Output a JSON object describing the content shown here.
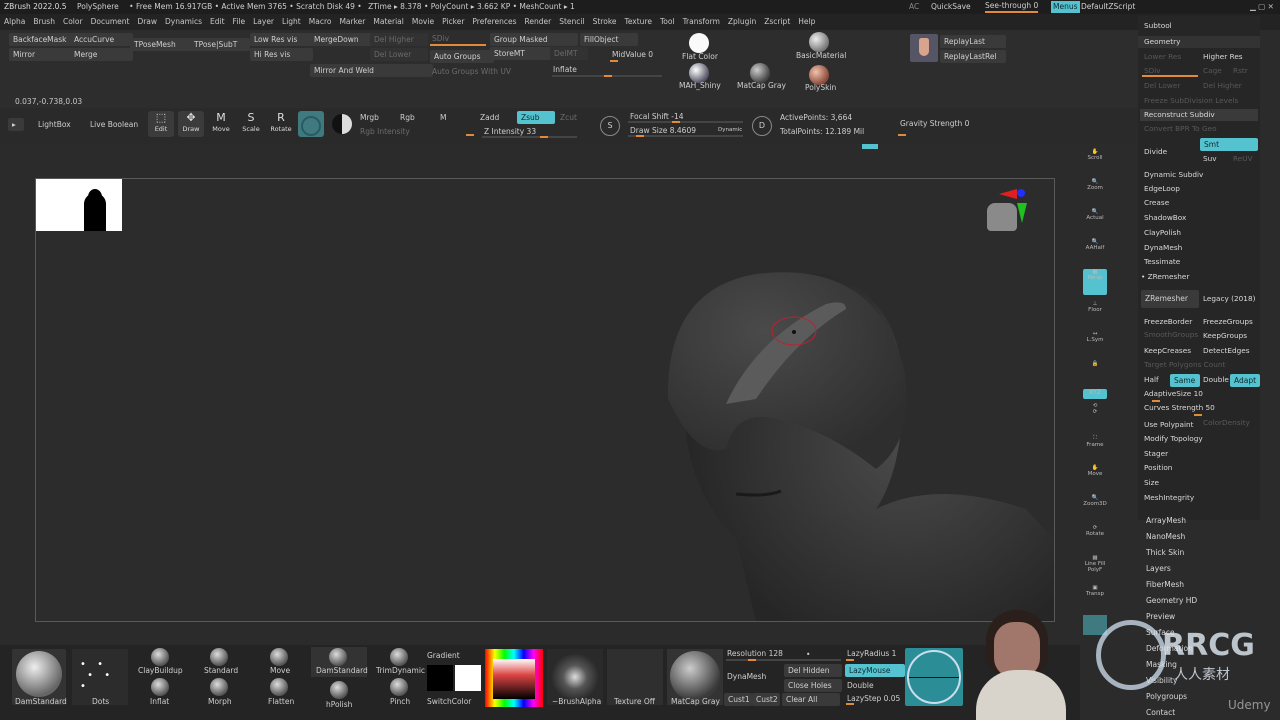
{
  "title_bar": {
    "app": "ZBrush 2022.0.5",
    "doc": "PolySphere",
    "stats": "• Free Mem 16.917GB • Active Mem 3765 • Scratch Disk 49 •",
    "ztime": "ZTime ▸ 8.378 • PolyCount ▸ 3.662 KP • MeshCount ▸ 1",
    "ac": "AC",
    "quicksave": "QuickSave",
    "seethrough": "See-through  0",
    "menus": "Menus",
    "script": "DefaultZScript"
  },
  "menu": [
    "Alpha",
    "Brush",
    "Color",
    "Document",
    "Draw",
    "Dynamics",
    "Edit",
    "File",
    "Layer",
    "Light",
    "Macro",
    "Marker",
    "Material",
    "Movie",
    "Picker",
    "Preferences",
    "Render",
    "Stencil",
    "Stroke",
    "Texture",
    "Tool",
    "Transform",
    "Zplugin",
    "Zscript",
    "Help"
  ],
  "toolbar_row1": {
    "backfacemask": "BackfaceMask",
    "accucurve": "AccuCurve",
    "tposemesh": "TPoseMesh",
    "tposesubt": "TPose|SubT",
    "lowresvis": "Low Res vis",
    "mergedown": "MergeDown",
    "delhigher": "Del Higher",
    "sdiv": "SDiv",
    "groupmasked": "Group Masked",
    "fillobject": "FillObject",
    "mirror": "Mirror",
    "merge": "Merge",
    "hiresvis": "Hi Res vis",
    "dellower": "Del Lower",
    "autogroups": "Auto Groups",
    "storemt": "StoreMT",
    "delmt": "DelMT",
    "midvalue": "MidValue 0",
    "mirrorandweld": "Mirror And Weld",
    "autogroupsuv": "Auto Groups With UV",
    "inflate": "Inflate",
    "flatcolor": "Flat Color",
    "basicmaterial": "BasicMaterial",
    "mahshiny": "MAH_Shiny",
    "matcapgray": "MatCap Gray",
    "polyskin": "PolySkin",
    "replaylast": "ReplayLast",
    "replaylastrel": "ReplayLastRel"
  },
  "coords": "0.037,-0.738,0.03",
  "toolbar_row2": {
    "lightbox": "LightBox",
    "liveboolean": "Live Boolean",
    "edit": "Edit",
    "draw": "Draw",
    "move": "Move",
    "scale": "Scale",
    "rotate": "Rotate",
    "mrgb": "Mrgb",
    "rgb": "Rgb",
    "m": "M",
    "rgbintensity": "Rgb Intensity",
    "zadd": "Zadd",
    "zsub": "Zsub",
    "zcut": "Zcut",
    "zintensity": "Z Intensity 33",
    "focalshift": "Focal Shift -14",
    "drawsize": "Draw Size 8.4609",
    "dynamic": "Dynamic",
    "activepoints": "ActivePoints: 3,664",
    "totalpoints": "TotalPoints: 12.189 Mil",
    "gravity": "Gravity Strength 0"
  },
  "right_icons": [
    "Scroll",
    "Zoom",
    "Actual",
    "AAHalf",
    "Persp",
    "Floor",
    "L.Sym",
    "Lock",
    "XYZ",
    "Frame",
    "Move",
    "Zoom3D",
    "Rotate",
    "Line Fill PolyF",
    "Transp"
  ],
  "subtool_panel": {
    "subtool": "Subtool",
    "geometry": "Geometry",
    "lowerres": "Lower Res",
    "higherres": "Higher Res",
    "sdiv": "SDiv",
    "cage": "Cage",
    "rstr": "Rstr",
    "dellower": "Del Lower",
    "delhigher": "Del Higher",
    "freezesub": "Freeze SubDivision Levels",
    "reconstruct": "Reconstruct Subdiv",
    "convertbpr": "Convert BPR To Geo",
    "divide": "Divide",
    "smt": "Smt",
    "suv": "Suv",
    "reuv": "ReUV",
    "dynsubdiv": "Dynamic Subdiv",
    "edgeloop": "EdgeLoop",
    "crease": "Crease",
    "shadowbox": "ShadowBox",
    "claypolish": "ClayPolish",
    "dynamesh": "DynaMesh",
    "tessimate": "Tessimate",
    "zremesher": "ZRemesher",
    "zremesherbtn": "ZRemesher",
    "legacy": "Legacy (2018)",
    "freezeborder": "FreezeBorder",
    "freezegroups": "FreezeGroups",
    "smoothgroups": "SmoothGroups",
    "keepgroups": "KeepGroups",
    "keepcreases": "KeepCreases",
    "detectedges": "DetectEdges",
    "targetpoly": "Target Polygons Count",
    "half": "Half",
    "same": "Same",
    "double": "Double",
    "adapt": "Adapt",
    "adaptivesize": "AdaptiveSize 10",
    "curvesstrength": "Curves Strength 50",
    "usepolypaint": "Use Polypaint",
    "colordensity": "ColorDensity",
    "modifytopology": "Modify Topology",
    "stager": "Stager",
    "position": "Position",
    "size": "Size",
    "meshintegrity": "MeshIntegrity"
  },
  "lower_list": [
    "ArrayMesh",
    "NanoMesh",
    "Thick Skin",
    "Layers",
    "FiberMesh",
    "Geometry HD",
    "Preview",
    "Surface",
    "Deformation",
    "Masking",
    "Visibility",
    "Polygroups",
    "Contact"
  ],
  "bottom_bar": {
    "damstandard": "DamStandard",
    "dots": "Dots",
    "claybuildup": "ClayBuildup",
    "standard": "Standard",
    "move": "Move",
    "damstandard2": "DamStandard",
    "trimdynamic": "TrimDynamic",
    "inflat": "Inflat",
    "morph": "Morph",
    "flatten": "Flatten",
    "hpolish": "hPolish",
    "pinch": "Pinch",
    "gradient": "Gradient",
    "switchcolor": "SwitchColor",
    "brushalpha": "~BrushAlpha",
    "textureoff": "Texture Off",
    "matcapgray": "MatCap Gray",
    "resolution": "Resolution 128",
    "dynamesh": "DynaMesh",
    "delhidden": "Del Hidden",
    "closeholes": "Close Holes",
    "cust1": "Cust1",
    "cust2": "Cust2",
    "clearall": "Clear All",
    "lazyradius": "LazyRadius 1",
    "lazymouse": "LazyMouse",
    "double": "Double",
    "lazystep": "LazyStep 0.05"
  },
  "watermark": {
    "brand": "RRCG",
    "sub": "人人素材",
    "udemy": "Udemy"
  },
  "colors": {
    "accent": "#55c2cf",
    "orange": "#e08a3a"
  }
}
